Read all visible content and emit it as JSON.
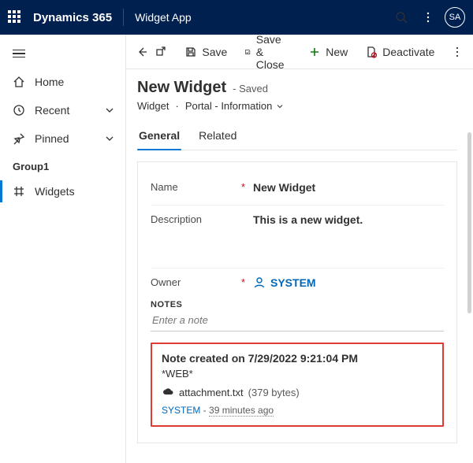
{
  "topbar": {
    "brand": "Dynamics 365",
    "app": "Widget App",
    "avatar": "SA"
  },
  "sidebar": {
    "home": "Home",
    "recent": "Recent",
    "pinned": "Pinned",
    "group": "Group1",
    "widgets": "Widgets"
  },
  "commands": {
    "save": "Save",
    "save_close": "Save & Close",
    "new": "New",
    "deactivate": "Deactivate"
  },
  "record": {
    "title": "New Widget",
    "state": "- Saved",
    "entity": "Widget",
    "form": "Portal - Information"
  },
  "tabs": {
    "general": "General",
    "related": "Related"
  },
  "fields": {
    "name_label": "Name",
    "name_value": "New Widget",
    "desc_label": "Description",
    "desc_value": "This is a new widget.",
    "owner_label": "Owner",
    "owner_value": "SYSTEM"
  },
  "notes": {
    "heading": "NOTES",
    "placeholder": "Enter a note",
    "title": "Note created on 7/29/2022 9:21:04 PM",
    "source": "*WEB*",
    "attachment_name": "attachment.txt",
    "attachment_size": "(379 bytes)",
    "author": "SYSTEM",
    "sep": " - ",
    "age": "39 minutes ago"
  }
}
